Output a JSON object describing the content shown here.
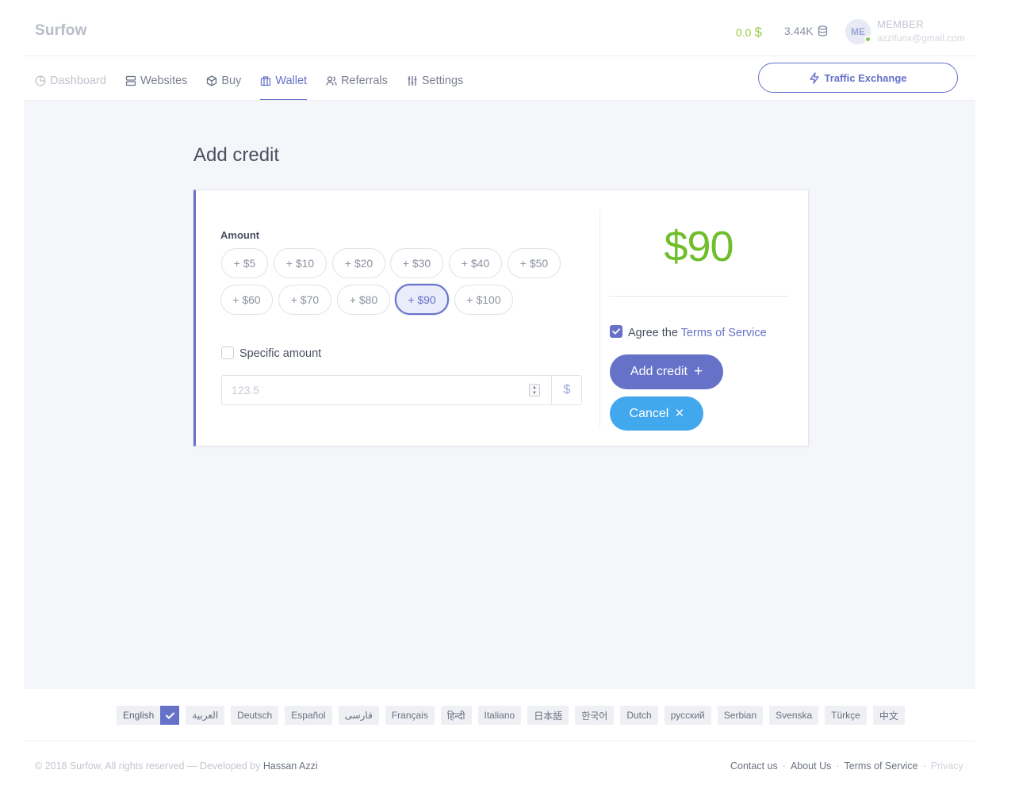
{
  "header": {
    "brand": "Surfow",
    "balance": "0.0",
    "balance_symbol": "$",
    "credits": "3.44K",
    "avatar_initials": "ME",
    "member_role": "MEMBER",
    "member_email": "azzifunx@gmail.com"
  },
  "nav": {
    "items": [
      {
        "label": "Dashboard",
        "icon": "clock-pie-icon"
      },
      {
        "label": "Websites",
        "icon": "server-icon"
      },
      {
        "label": "Buy",
        "icon": "box-icon"
      },
      {
        "label": "Wallet",
        "icon": "wallet-icon"
      },
      {
        "label": "Referrals",
        "icon": "users-icon"
      },
      {
        "label": "Settings",
        "icon": "sliders-icon"
      }
    ],
    "active": "Wallet",
    "traffic_button": "Traffic Exchange"
  },
  "page": {
    "title": "Add credit",
    "amount_label": "Amount",
    "amount_options": [
      "+ $5",
      "+ $10",
      "+ $20",
      "+ $30",
      "+ $40",
      "+ $50",
      "+ $60",
      "+ $70",
      "+ $80",
      "+ $90",
      "+ $100"
    ],
    "selected_amount": "+ $90",
    "specific_amount_label": "Specific amount",
    "specific_amount_checked": false,
    "amount_placeholder": "123.5",
    "currency_addon": "$",
    "total_display": "$90",
    "agree_prefix": "Agree the",
    "tos_link": "Terms of Service",
    "agree_checked": true,
    "add_credit_button": "Add credit",
    "add_credit_symbol": "+",
    "cancel_button": "Cancel",
    "cancel_symbol": "×"
  },
  "languages": {
    "items": [
      "English",
      "العربية",
      "Deutsch",
      "Español",
      "فارسی",
      "Français",
      "हिन्दी",
      "Italiano",
      "日本語",
      "한국어",
      "Dutch",
      "русский",
      "Serbian",
      "Svenska",
      "Türkçe",
      "中文"
    ],
    "active": "English"
  },
  "footer": {
    "copyright": "© 2018 Surfow, All rights reserved — Developed by",
    "developer": "Hassan Azzi",
    "links": [
      "Contact us",
      "About Us",
      "Terms of Service",
      "Privacy"
    ],
    "separator": "·"
  },
  "colors": {
    "accent": "#6672c8",
    "success": "#6fbe2a",
    "info": "#41a8ee"
  }
}
